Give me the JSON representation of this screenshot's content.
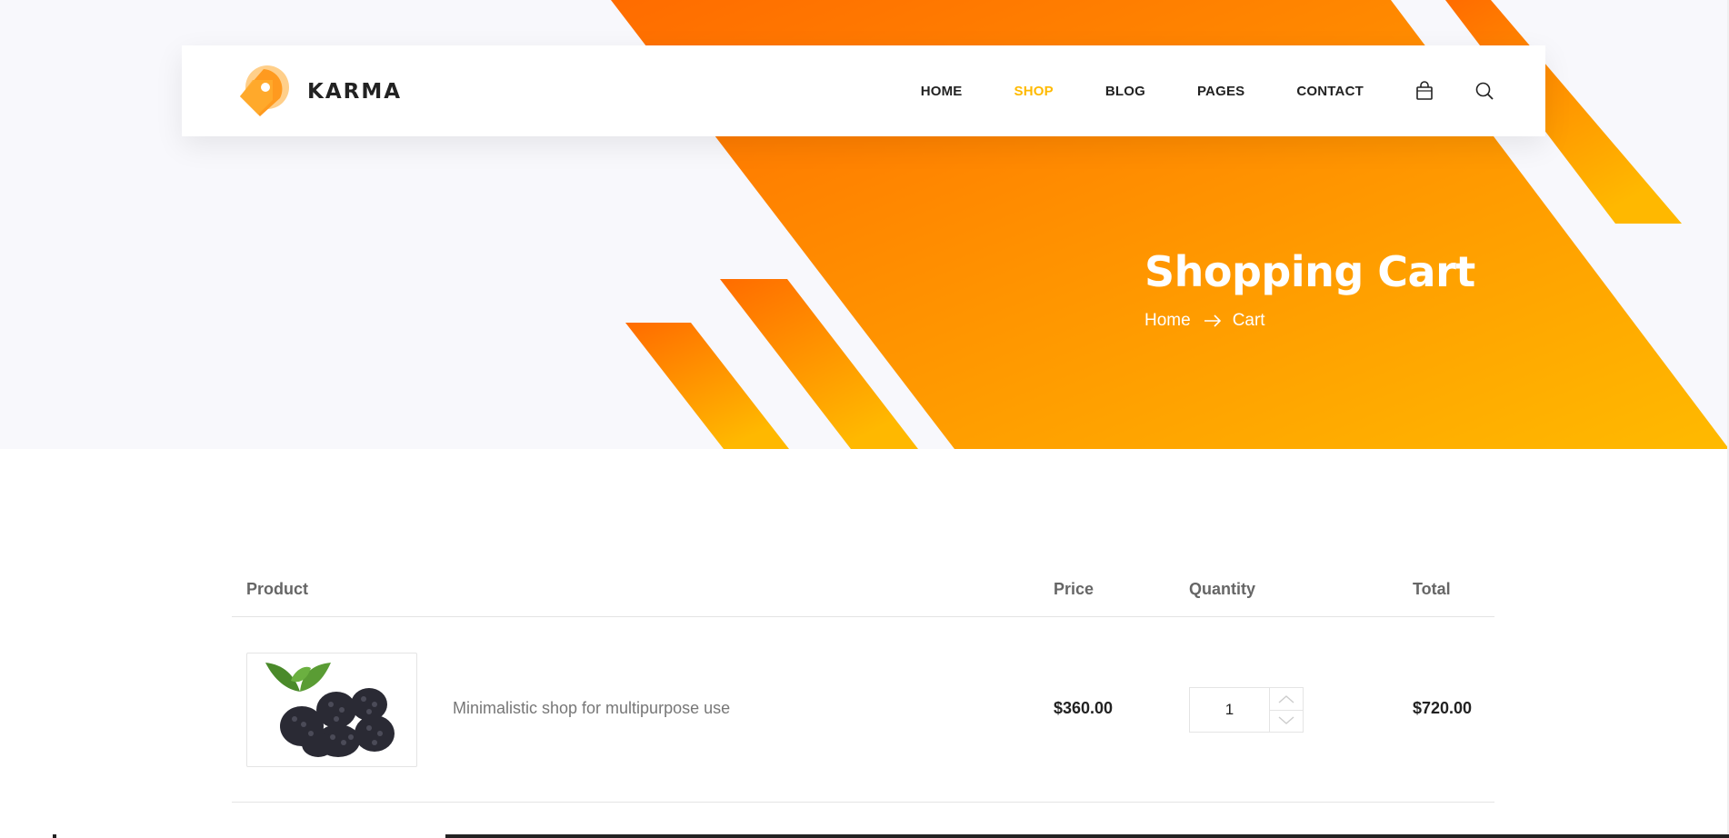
{
  "brand": {
    "name": "KARMA",
    "accent": "#ffba00",
    "orange": "#ff6c00"
  },
  "nav": {
    "items": [
      {
        "label": "HOME",
        "active": false
      },
      {
        "label": "SHOP",
        "active": true
      },
      {
        "label": "BLOG",
        "active": false
      },
      {
        "label": "PAGES",
        "active": false
      },
      {
        "label": "CONTACT",
        "active": false
      }
    ],
    "icons": [
      "shopping-bag-icon",
      "search-icon"
    ]
  },
  "banner": {
    "title": "Shopping Cart",
    "breadcrumb": {
      "home": "Home",
      "current": "Cart"
    }
  },
  "cart": {
    "headers": {
      "product": "Product",
      "price": "Price",
      "quantity": "Quantity",
      "total": "Total"
    },
    "items": [
      {
        "name": "Minimalistic shop for multipurpose use",
        "price": "$360.00",
        "quantity": "1",
        "total": "$720.00",
        "image": "blackberries"
      }
    ]
  }
}
